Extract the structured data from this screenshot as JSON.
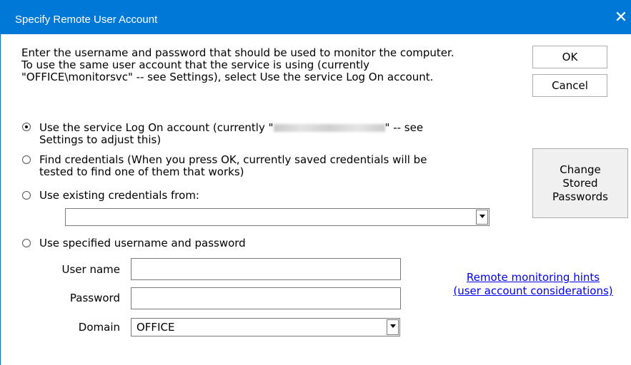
{
  "window": {
    "title": "Specify Remote User Account",
    "close_glyph": "✕"
  },
  "intro": "Enter the username and password that should be used to monitor the computer.\n To use the same user account that the service is using (currently\n\"OFFICE\\monitorsvc\" -- see Settings), select Use the service Log On account.",
  "buttons": {
    "ok": "OK",
    "cancel": "Cancel",
    "change_passwords": "Change\nStored\nPasswords"
  },
  "options": {
    "service_account_prefix": "Use the service Log On account (currently \"",
    "service_account_suffix": "\" -- see",
    "service_account_line2": "Settings to adjust this)",
    "find_credentials_line1": "Find credentials (When you press OK, currently saved credentials will be",
    "find_credentials_line2": "tested to find one of them that works)",
    "existing_credentials": "Use existing credentials from:",
    "specified": "Use specified username and password",
    "selected": "service_account"
  },
  "existing_credentials_value": "",
  "fields": {
    "username_label": "User name",
    "username_value": "",
    "password_label": "Password",
    "password_value": "",
    "domain_label": "Domain",
    "domain_value": "OFFICE"
  },
  "hint_link": "Remote monitoring hints\n(user account considerations)",
  "colors": {
    "title_bar": "#0078d7",
    "link": "#0000ee"
  }
}
